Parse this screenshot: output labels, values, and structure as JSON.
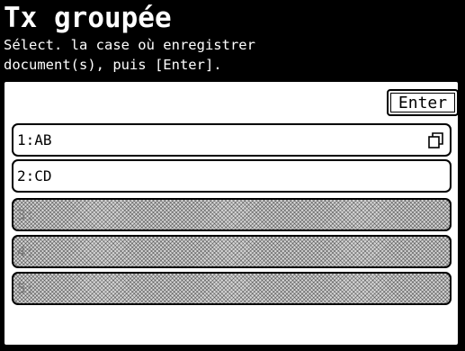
{
  "header": {
    "title": "Tx groupée",
    "instruction_line1": "Sélect. la case où enregistrer",
    "instruction_line2": "document(s), puis [Enter]."
  },
  "toolbar": {
    "enter_label": "Enter"
  },
  "boxes": [
    {
      "label": "1:AB",
      "has_document": true,
      "icon": "document-icon"
    },
    {
      "label": "2:CD",
      "has_document": false
    },
    {
      "label": "3:",
      "empty": true
    },
    {
      "label": "4:",
      "empty": true
    },
    {
      "label": "5:",
      "empty": true
    }
  ],
  "colors": {
    "header_bg": "#000000",
    "header_text": "#ffffff",
    "panel_bg": "#ffffff",
    "empty_box_pattern": "#d6d6d6"
  }
}
